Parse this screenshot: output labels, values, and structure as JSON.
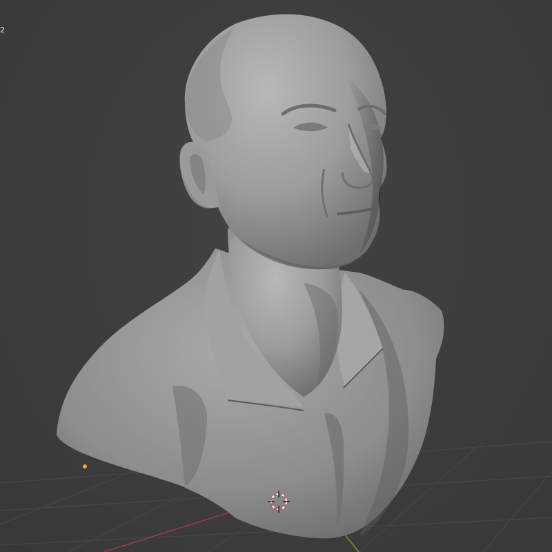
{
  "viewport": {
    "overlay_text": "2",
    "colors": {
      "background": "#3d3d3d",
      "grid": "#474747",
      "x_axis": "#9a3c48",
      "y_axis": "#6f9a2a",
      "model": "#9e9e9e",
      "origin_dot": "#f2a24a",
      "cursor_red": "#e04a4a",
      "cursor_white": "#ffffff"
    },
    "objects": {
      "model_name": "bust-sculpt",
      "light_marker": "orange-origin-dot",
      "cursor": "3d-cursor-icon"
    }
  }
}
